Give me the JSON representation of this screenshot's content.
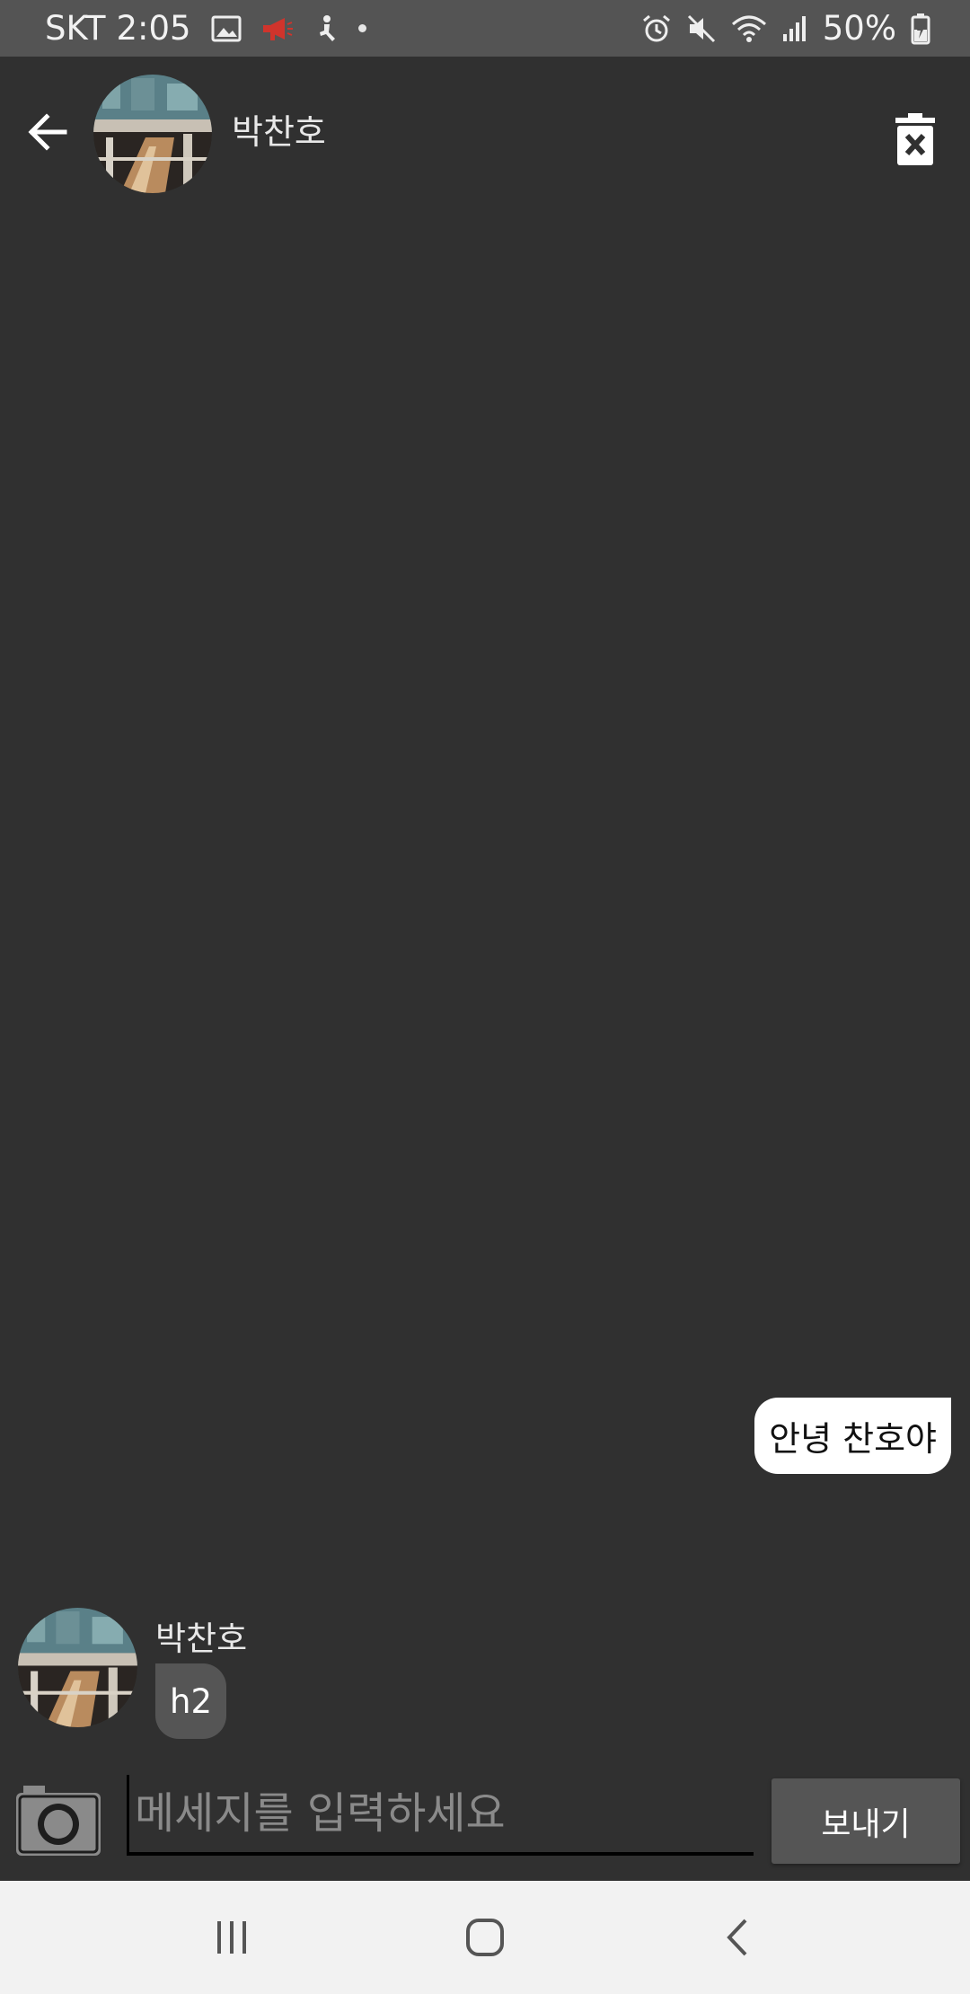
{
  "status_bar": {
    "carrier": "SKT",
    "time": "2:05",
    "battery": "50%",
    "left_icons": [
      "image-icon",
      "megaphone-icon",
      "accessibility-icon",
      "dot-icon"
    ],
    "right_icons": [
      "alarm-icon",
      "mute-icon",
      "wifi-icon",
      "signal-icon",
      "battery-icon"
    ],
    "alert_color": "#d0342c"
  },
  "header": {
    "contact_name": "박찬호",
    "back_icon": "arrow-left-icon",
    "delete_icon": "trash-x-icon"
  },
  "messages": [
    {
      "direction": "sent",
      "text": "안녕 찬호야"
    },
    {
      "direction": "received",
      "sender": "박찬호",
      "text": "h2"
    }
  ],
  "composer": {
    "camera_icon": "camera-icon",
    "placeholder": "메세지를 입력하세요",
    "value": "",
    "send_label": "보내기"
  },
  "nav_bar": {
    "items": [
      "recents-icon",
      "home-icon",
      "back-icon"
    ]
  },
  "colors": {
    "background": "#303030",
    "status_bar": "#545454",
    "received_bubble": "#555555",
    "sent_bubble": "#ffffff",
    "send_button": "#555555",
    "nav_bar": "#f2f2f2"
  }
}
